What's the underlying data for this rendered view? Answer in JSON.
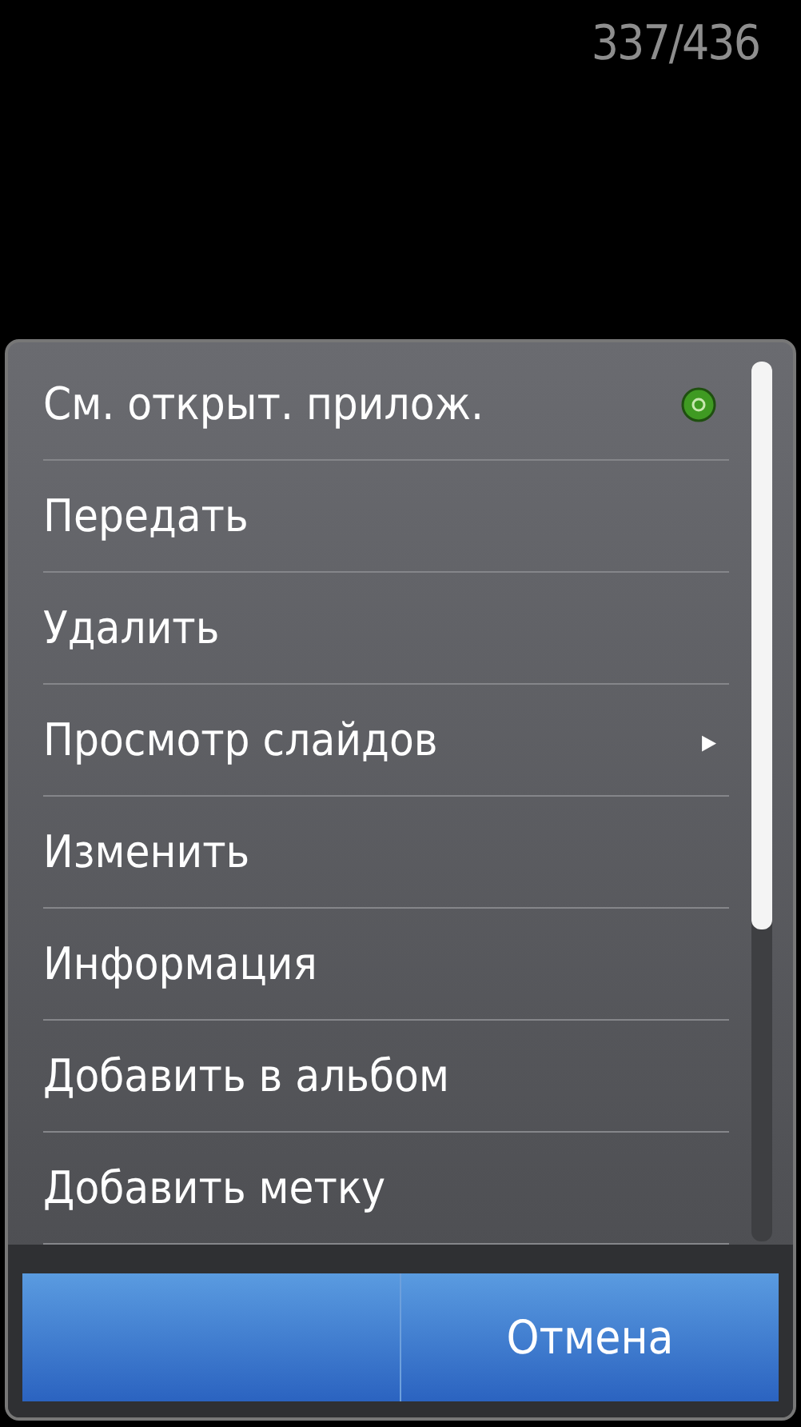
{
  "counter": "337/436",
  "menu": {
    "items": [
      {
        "label": "См. открыт. прилож.",
        "kind": "indicator"
      },
      {
        "label": "Передать",
        "kind": "plain"
      },
      {
        "label": "Удалить",
        "kind": "plain"
      },
      {
        "label": "Просмотр слайдов",
        "kind": "submenu",
        "arrow": "▸"
      },
      {
        "label": "Изменить",
        "kind": "plain"
      },
      {
        "label": "Информация",
        "kind": "plain"
      },
      {
        "label": "Добавить в альбом",
        "kind": "plain"
      },
      {
        "label": "Добавить метку",
        "kind": "plain"
      }
    ]
  },
  "buttons": [
    {
      "kind": "blank"
    },
    {
      "kind": "text",
      "label": "Отмена"
    }
  ]
}
